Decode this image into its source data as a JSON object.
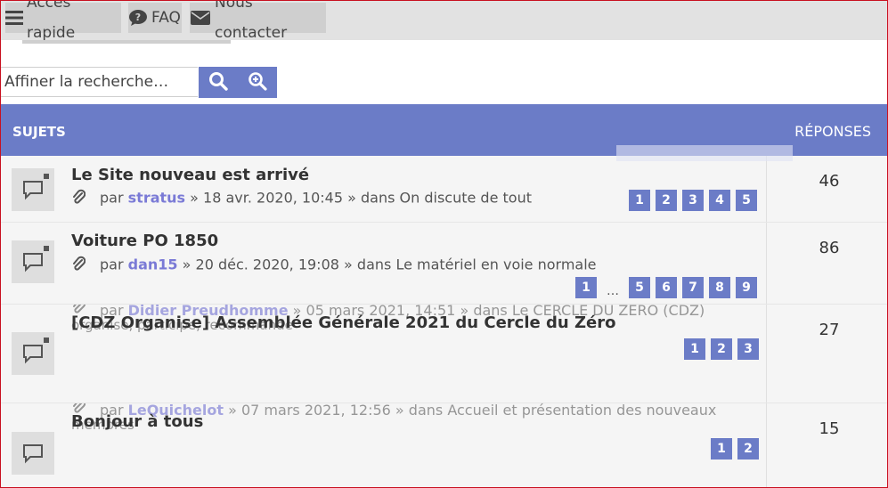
{
  "nav": {
    "quick_access": "Accès rapide",
    "faq": "FAQ",
    "contact": "Nous contacter"
  },
  "search": {
    "placeholder": "Affiner la recherche…"
  },
  "table": {
    "col_topics": "SUJETS",
    "col_replies": "RÉPONSES"
  },
  "topics": [
    {
      "title": "Le Site nouveau est arrivé",
      "by": "par",
      "author": "stratus",
      "date": "» 18 avr. 2020, 10:45 »",
      "in_label": "dans",
      "forum": "On discute de tout",
      "pages": [
        "1",
        "2",
        "3",
        "4",
        "5"
      ],
      "replies": "46"
    },
    {
      "title": "Voiture PO 1850",
      "by": "par",
      "author": "dan15",
      "date": "» 20 déc. 2020, 19:08 »",
      "in_label": "dans",
      "forum": "Le matériel en voie normale",
      "pages": [
        "1",
        "…",
        "5",
        "6",
        "7",
        "8",
        "9"
      ],
      "replies": "86"
    },
    {
      "title": "[CDZ Organise] Assemblée Générale 2021 du Cercle du Zéro",
      "by": "par",
      "author": "Didier Preudhomme",
      "date": "» 05 mars 2021, 14:51 »",
      "in_label": "dans",
      "forum": "Le CERCLE DU ZERO (CDZ)",
      "forum_cont": "organise, participe, recommande",
      "pages": [
        "1",
        "2",
        "3"
      ],
      "replies": "27"
    },
    {
      "title": "Bonjour à tous",
      "by": "par",
      "author": "LeQuichelot",
      "date": "» 07 mars 2021, 12:56 »",
      "in_label": "dans",
      "forum": "Accueil et présentation des nouveaux",
      "forum_cont": "membres",
      "pages": [
        "1",
        "2"
      ],
      "replies": "15"
    }
  ],
  "colors": {
    "accent": "#6b7cc7",
    "author": "#7a7ad6",
    "nav_bg": "#e2e2e2",
    "row_bg": "#f5f5f5"
  },
  "icons": [
    "bars-icon",
    "question-icon",
    "envelope-icon",
    "search-icon",
    "zoom-plus-icon",
    "topic-bubble-icon",
    "paperclip-icon"
  ]
}
